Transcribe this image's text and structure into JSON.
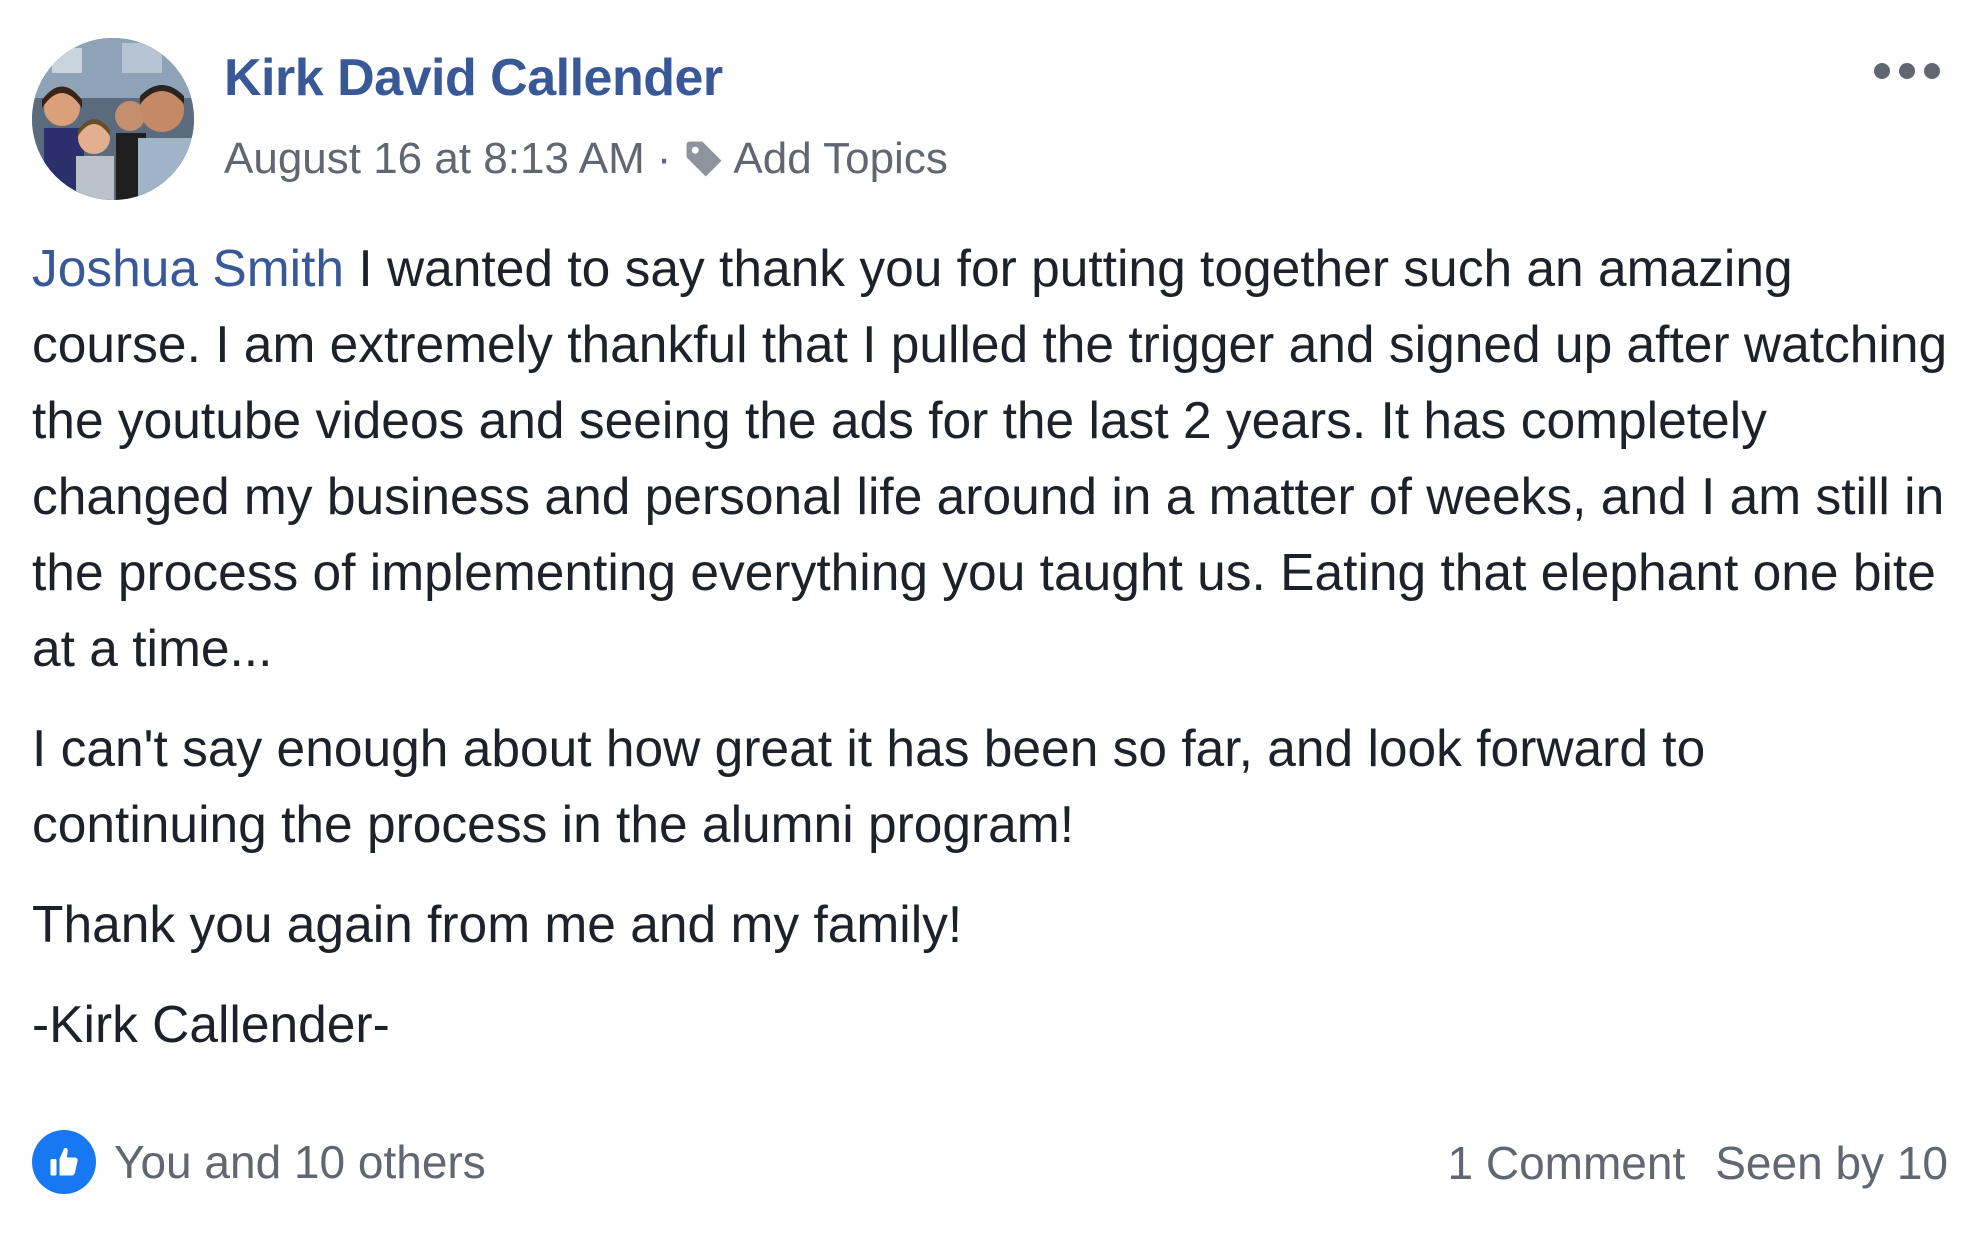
{
  "post": {
    "author": "Kirk David Callender",
    "timestamp": "August 16 at 8:13 AM",
    "separator": "·",
    "add_topics_label": "Add Topics",
    "mention": "Joshua Smith",
    "paragraph1_rest": " I wanted to say thank you for putting together such an amazing course. I am extremely thankful that I pulled the trigger and signed up after watching the youtube videos and seeing the ads for the last 2 years. It has completely changed my business and personal life around in a matter of weeks, and I am still in the process of implementing everything you taught us. Eating that elephant one bite at a time...",
    "paragraph2": "I can't say enough about how great it has been so far, and look forward to continuing the process in the alumni program!",
    "paragraph3": "Thank you again from me and my family!",
    "signature": "-Kirk Callender-"
  },
  "footer": {
    "likes_text": "You and 10 others",
    "comments": "1 Comment",
    "seen_by": "Seen by 10"
  },
  "colors": {
    "link": "#385898",
    "meta": "#616770",
    "like_blue": "#1877f2"
  },
  "icons": {
    "tag": "tag-icon",
    "more": "more-options-icon",
    "like": "thumbs-up-icon"
  }
}
